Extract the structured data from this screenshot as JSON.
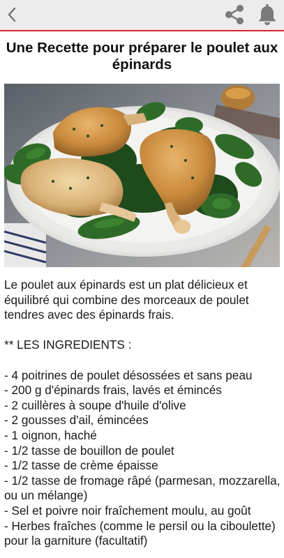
{
  "header": {
    "back_icon": "chevron-left-icon",
    "share_icon": "share-icon",
    "notification_icon": "bell-icon",
    "accent_color": "#d9232e",
    "background_color": "#ececec"
  },
  "article": {
    "title": "Une Recette pour préparer le poulet aux épinards",
    "image_description": "poulet-epinards-photo",
    "intro": "Le poulet aux épinards est un plat délicieux et équilibré qui combine des morceaux de poulet tendres avec des épinards frais.",
    "ingredients_heading": "** LES INGREDIENTS :",
    "ingredients": [
      "- 4 poitrines de poulet désossées et sans peau",
      "- 200 g d'épinards frais, lavés et émincés",
      "- 2 cuillères à soupe d'huile d'olive",
      "- 2 gousses d'ail, émincées",
      "- 1 oignon, haché",
      "- 1/2 tasse de bouillon de poulet",
      "- 1/2 tasse de crème épaisse",
      "- 1/2 tasse de fromage râpé (parmesan, mozzarella, ou un mélange)",
      "- Sel et poivre noir fraîchement moulu, au goût",
      "- Herbes fraîches (comme le persil ou la ciboulette) pour la garniture (facultatif)"
    ]
  }
}
